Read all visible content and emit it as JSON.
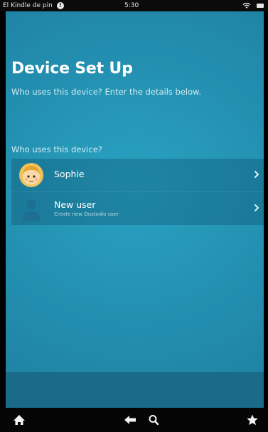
{
  "status_bar": {
    "carrier": "El Kindle de pin",
    "time": "5:30"
  },
  "page": {
    "title": "Device Set Up",
    "subtitle": "Who uses this device? Enter the details below.",
    "section_label": "Who uses this device?"
  },
  "users": [
    {
      "name": "Sophie",
      "description": ""
    },
    {
      "name": "New user",
      "description": "Create new Qustodio user"
    }
  ],
  "icons": {
    "status": [
      "info-icon",
      "wifi-icon",
      "battery-icon"
    ],
    "rows": [
      "sophie-avatar",
      "default-user-avatar",
      "chevron-right-icon"
    ],
    "nav": [
      "home-icon",
      "back-arrow-icon",
      "search-icon",
      "favorites-star-icon"
    ]
  },
  "colors": {
    "app_background": "#2390b1",
    "status_bar": "#0b0b0b",
    "nav_bar": "#050505"
  }
}
